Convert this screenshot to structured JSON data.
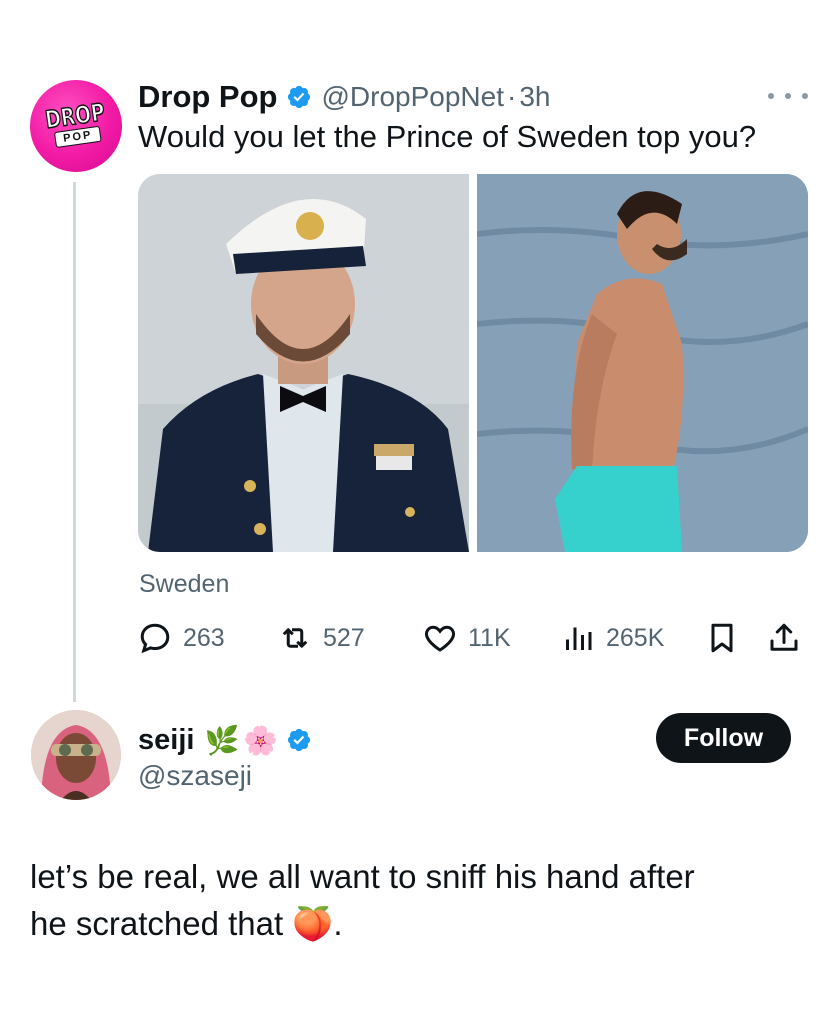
{
  "post": {
    "display_name": "Drop Pop",
    "handle": "@DropPopNet",
    "separator": "·",
    "time": "3h",
    "text": "Would you let the Prince of Sweden top you?",
    "avatar_logo_line1": "DROP",
    "avatar_logo_line2": "POP",
    "location": "Sweden",
    "stats": {
      "replies": "263",
      "reposts": "527",
      "likes": "11K",
      "views": "265K"
    },
    "media": [
      {
        "description_icon": "photo-prince-in-naval-uniform"
      },
      {
        "description_icon": "photo-shirtless-man-by-sea"
      }
    ]
  },
  "reply": {
    "display_name": "seiji",
    "emojis": [
      "🌿",
      "🌸"
    ],
    "handle": "@szaseji",
    "follow_label": "Follow",
    "text_line1": "let’s be real, we all want to sniff his hand after",
    "text_line2": "he scratched that",
    "text_emoji": "🍑",
    "text_end": "."
  },
  "colors": {
    "verified_blue": "#1d9bf0",
    "text_primary": "#0f1419",
    "text_secondary": "#536471",
    "brand_pink": "#f21aa5"
  }
}
